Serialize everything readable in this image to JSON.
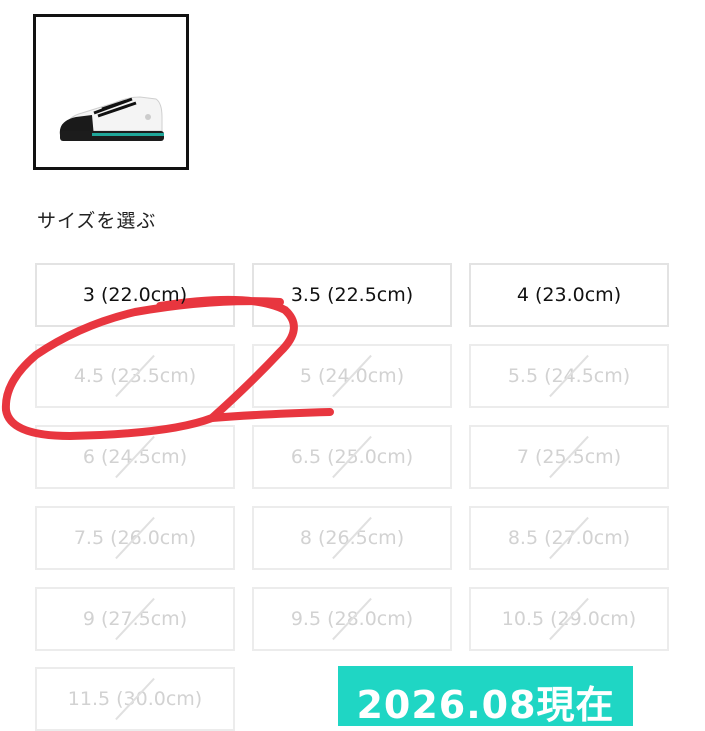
{
  "product": {
    "thumbnail_icon": "sneaker-image"
  },
  "section_title": "サイズを選ぶ",
  "sizes": [
    {
      "label": "3 (22.0cm)",
      "available": true
    },
    {
      "label": "3.5 (22.5cm)",
      "available": true
    },
    {
      "label": "4 (23.0cm)",
      "available": true
    },
    {
      "label": "4.5 (23.5cm)",
      "available": false
    },
    {
      "label": "5 (24.0cm)",
      "available": false
    },
    {
      "label": "5.5 (24.5cm)",
      "available": false
    },
    {
      "label": "6 (24.5cm)",
      "available": false
    },
    {
      "label": "6.5 (25.0cm)",
      "available": false
    },
    {
      "label": "7 (25.5cm)",
      "available": false
    },
    {
      "label": "7.5 (26.0cm)",
      "available": false
    },
    {
      "label": "8 (26.5cm)",
      "available": false
    },
    {
      "label": "8.5 (27.0cm)",
      "available": false
    },
    {
      "label": "9 (27.5cm)",
      "available": false
    },
    {
      "label": "9.5 (28.0cm)",
      "available": false
    },
    {
      "label": "10.5 (29.0cm)",
      "available": false
    },
    {
      "label": "11.5 (30.0cm)",
      "available": false
    }
  ],
  "badge": {
    "text": "2026.08現在",
    "color": "#1fd6c4"
  },
  "annotation": {
    "color": "#e8363f"
  }
}
